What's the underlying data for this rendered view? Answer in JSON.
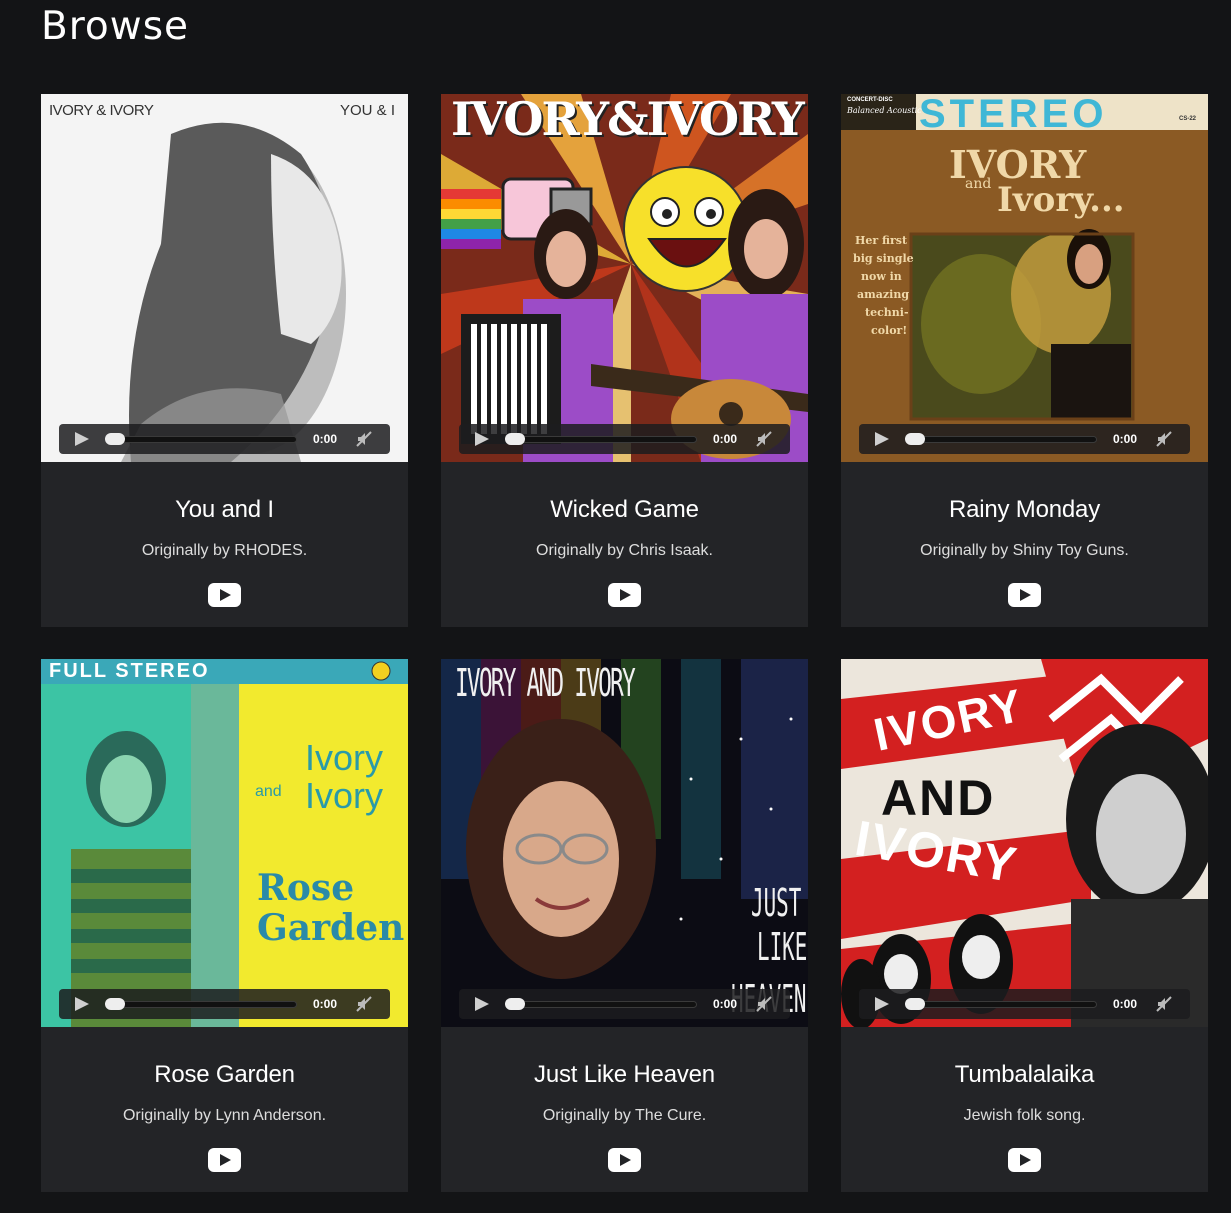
{
  "page": {
    "title": "Browse"
  },
  "songs": [
    {
      "title": "You and I",
      "credit": "Originally by RHODES.",
      "art_text": [
        "IVORY & IVORY",
        "YOU & I"
      ],
      "player": {
        "time": "0:00",
        "progress": 0
      }
    },
    {
      "title": "Wicked Game",
      "credit": "Originally by Chris Isaak.",
      "art_text": [
        "IVORY&IVORY"
      ],
      "player": {
        "time": "0:00",
        "progress": 0
      }
    },
    {
      "title": "Rainy Monday",
      "credit": "Originally by Shiny Toy Guns.",
      "art_text": [
        "CONCERT-DISC",
        "Balanced Acoustic",
        "STEREO",
        "CS-22",
        "IVORY",
        "and",
        "Ivory...",
        "Her first",
        "big single",
        "now in",
        "amazing",
        "techni-",
        "color!"
      ],
      "player": {
        "time": "0:00",
        "progress": 0
      }
    },
    {
      "title": "Rose Garden",
      "credit": "Originally by Lynn Anderson.",
      "art_text": [
        "FULL STEREO",
        "Ivory",
        "and",
        "Ivory",
        "Rose",
        "Garden"
      ],
      "player": {
        "time": "0:00",
        "progress": 0
      }
    },
    {
      "title": "Just Like Heaven",
      "credit": "Originally by The Cure.",
      "art_text": [
        "IVORY AND IVORY",
        "JUST",
        "LIKE",
        "HEAVEN"
      ],
      "player": {
        "time": "0:00",
        "progress": 0
      }
    },
    {
      "title": "Tumbalalaika",
      "credit": "Jewish folk song.",
      "art_text": [
        "IVORY",
        "AND",
        "IVORY"
      ],
      "player": {
        "time": "0:00",
        "progress": 0
      }
    }
  ]
}
